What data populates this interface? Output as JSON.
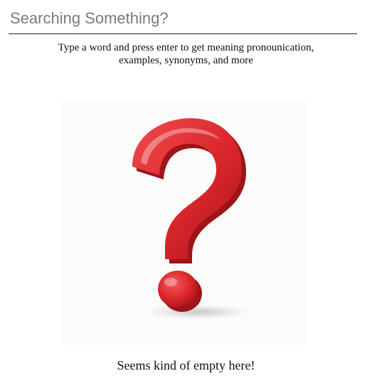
{
  "search": {
    "placeholder": "Searching Something?",
    "value": ""
  },
  "hint_text": "Type a word and press enter to get meaning pronounication, examples, synonyms, and more",
  "empty_state": {
    "illustration_icon": "question-mark-icon",
    "message": "Seems kind of empty here!"
  },
  "colors": {
    "accent_red": "#d9262b",
    "background": "#ffffff"
  }
}
